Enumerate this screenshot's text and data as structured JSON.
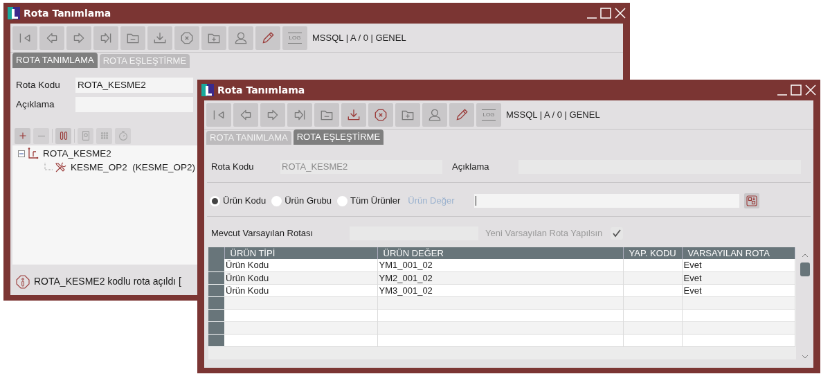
{
  "windows": [
    {
      "kind": "tree_form",
      "title": "Rota Tanımlama",
      "toolbar": {
        "buttons": [
          {
            "kind": "first",
            "active": false
          },
          {
            "kind": "prev",
            "active": false
          },
          {
            "kind": "next",
            "active": false
          },
          {
            "kind": "last",
            "active": false
          },
          {
            "kind": "folder_minus",
            "active": false
          },
          {
            "kind": "download",
            "active": false
          },
          {
            "kind": "cancel",
            "active": false
          },
          {
            "kind": "folder_plus",
            "active": false
          },
          {
            "kind": "user",
            "active": false
          },
          {
            "kind": "pencil",
            "active": true
          },
          {
            "kind": "log",
            "active": false,
            "label": "LOG"
          }
        ],
        "info": "MSSQL | A / 0 | GENEL"
      },
      "tabs": [
        {
          "label": "ROTA TANIMLAMA",
          "selected": true
        },
        {
          "label": "ROTA EŞLEŞTİRME",
          "selected": false
        }
      ],
      "fields": [
        {
          "label": "Rota Kodu",
          "value": "ROTA_KESME2"
        },
        {
          "label": "Açıklama"
        }
      ],
      "tree_toolbar": [
        {
          "kind": "add",
          "enabled": true
        },
        {
          "kind": "remove",
          "enabled": false
        },
        {
          "kind": "columns",
          "enabled": true
        },
        {
          "kind": "chip",
          "enabled": false
        },
        {
          "kind": "dots",
          "enabled": false
        },
        {
          "kind": "timer",
          "enabled": false
        }
      ],
      "tree": [
        {
          "label": "ROTA_KESME2",
          "kind": "route",
          "expanded": true,
          "children": [
            {
              "label": "KESME_OP2  (KESME_OP2)",
              "kind": "operation"
            }
          ]
        }
      ],
      "status": "ROTA_KESME2 kodlu rota açıldı ["
    },
    {
      "kind": "mapping_form",
      "title": "Rota Tanımlama",
      "toolbar": {
        "buttons": [
          {
            "kind": "first",
            "active": false
          },
          {
            "kind": "prev",
            "active": false
          },
          {
            "kind": "next",
            "active": false
          },
          {
            "kind": "last",
            "active": false
          },
          {
            "kind": "folder_minus",
            "active": false
          },
          {
            "kind": "download",
            "active": true
          },
          {
            "kind": "cancel",
            "active": true
          },
          {
            "kind": "folder_plus",
            "active": false
          },
          {
            "kind": "user",
            "active": false
          },
          {
            "kind": "pencil",
            "active": true
          },
          {
            "kind": "log",
            "active": false,
            "label": "LOG"
          }
        ],
        "info": "MSSQL | A / 0 | GENEL"
      },
      "tabs": [
        {
          "label": "ROTA TANIMLAMA",
          "selected": false
        },
        {
          "label": "ROTA EŞLEŞTİRME",
          "selected": true
        }
      ],
      "fields": [
        {
          "label": "Rota Kodu",
          "value": "ROTA_KESME2"
        },
        {
          "label": "Açıklama"
        }
      ],
      "radios": [
        {
          "label": "Ürün Kodu",
          "selected": true
        },
        {
          "label": "Ürün Grubu",
          "selected": false
        },
        {
          "label": "Tüm Ürünler",
          "selected": false
        }
      ],
      "value_field": {
        "label": "Ürün Değer"
      },
      "default_route": {
        "label": "Mevcut Varsayılan Rotası",
        "check_label": "Yeni Varsayılan Rota Yapılsın",
        "checked": true
      },
      "table": {
        "columns": [
          "ÜRÜN TİPİ",
          "ÜRÜN DEĞER",
          "YAP. KODU",
          "VARSAYILAN ROTA"
        ],
        "rows": [
          [
            "Ürün Kodu",
            "YM1_001_02",
            "",
            "Evet"
          ],
          [
            "Ürün Kodu",
            "YM2_001_02",
            "",
            "Evet"
          ],
          [
            "Ürün Kodu",
            "YM3_001_02",
            "",
            "Evet"
          ]
        ]
      }
    }
  ]
}
